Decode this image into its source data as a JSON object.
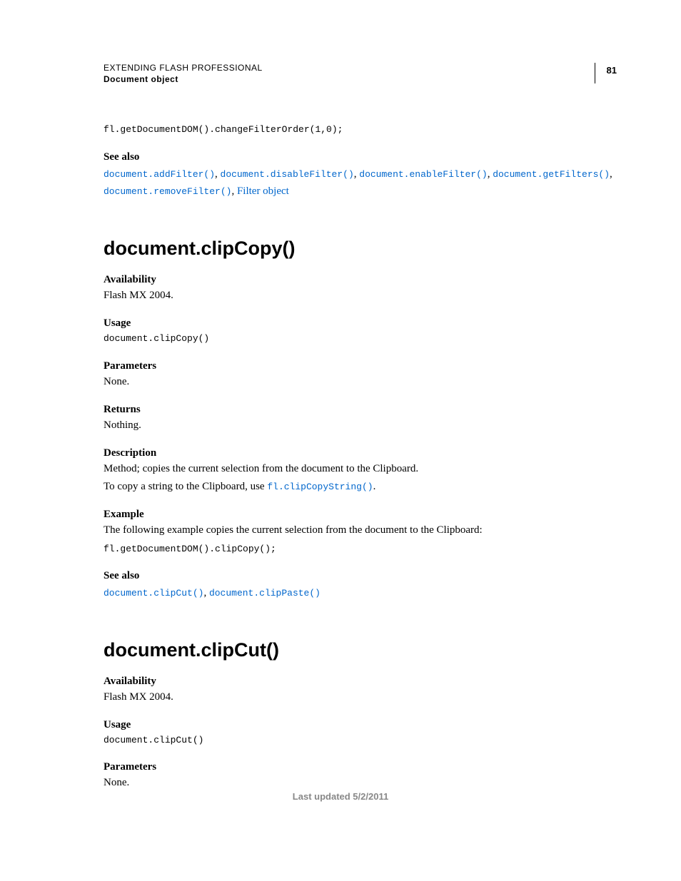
{
  "header": {
    "title": "EXTENDING FLASH PROFESSIONAL",
    "subtitle": "Document object",
    "page_number": "81"
  },
  "intro_code": "fl.getDocumentDOM().changeFilterOrder(1,0);",
  "see_also_1": {
    "label": "See also",
    "links": [
      "document.addFilter()",
      "document.disableFilter()",
      "document.enableFilter()",
      "document.getFilters()",
      "document.removeFilter()"
    ],
    "trailing_text_link": "Filter object"
  },
  "sections": [
    {
      "heading": "document.clipCopy()",
      "availability_label": "Availability",
      "availability_text": "Flash MX 2004.",
      "usage_label": "Usage",
      "usage_code": "document.clipCopy()",
      "parameters_label": "Parameters",
      "parameters_text": "None.",
      "returns_label": "Returns",
      "returns_text": "Nothing.",
      "description_label": "Description",
      "description_text": "Method; copies the current selection from the document to the Clipboard.",
      "description_extra_pre": "To copy a string to the Clipboard, use ",
      "description_extra_link": "fl.clipCopyString()",
      "description_extra_post": ".",
      "example_label": "Example",
      "example_text": "The following example copies the current selection from the document to the Clipboard:",
      "example_code": "fl.getDocumentDOM().clipCopy();",
      "see_also_label": "See also",
      "see_also_links": [
        "document.clipCut()",
        "document.clipPaste()"
      ]
    },
    {
      "heading": "document.clipCut()",
      "availability_label": "Availability",
      "availability_text": "Flash MX 2004.",
      "usage_label": "Usage",
      "usage_code": "document.clipCut()",
      "parameters_label": "Parameters",
      "parameters_text": "None."
    }
  ],
  "footer": "Last updated 5/2/2011"
}
